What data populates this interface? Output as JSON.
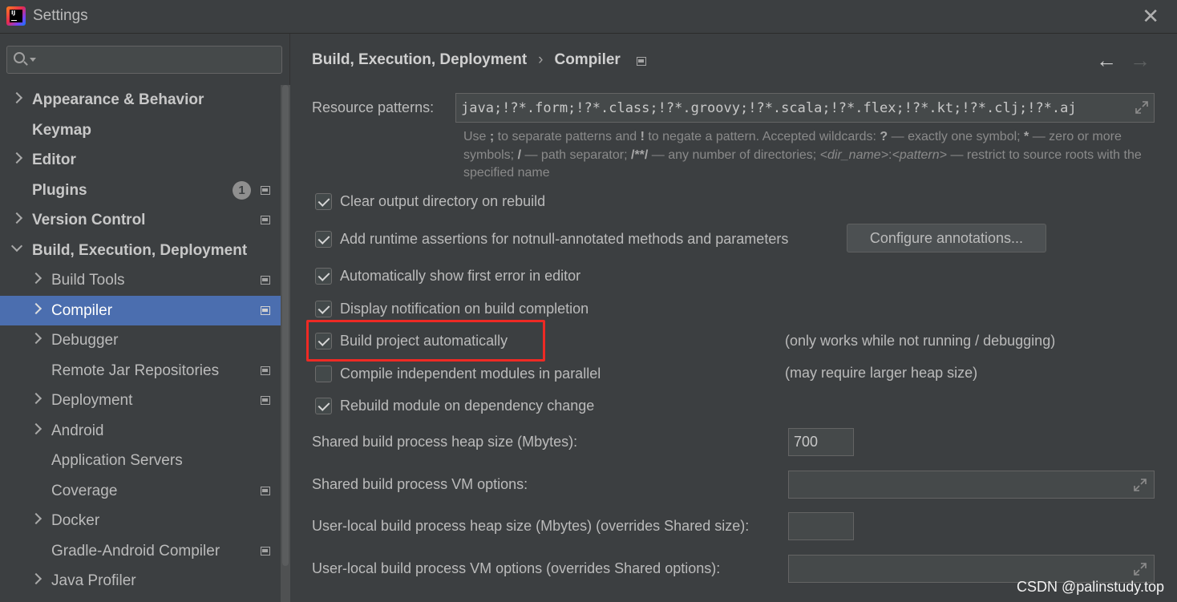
{
  "window": {
    "title": "Settings"
  },
  "search": {
    "value": "",
    "placeholder": ""
  },
  "sidebar": {
    "items": [
      {
        "label": "Appearance & Behavior"
      },
      {
        "label": "Keymap"
      },
      {
        "label": "Editor"
      },
      {
        "label": "Plugins",
        "badge": "1"
      },
      {
        "label": "Version Control"
      },
      {
        "label": "Build, Execution, Deployment"
      },
      {
        "label": "Build Tools"
      },
      {
        "label": "Compiler"
      },
      {
        "label": "Debugger"
      },
      {
        "label": "Remote Jar Repositories"
      },
      {
        "label": "Deployment"
      },
      {
        "label": "Android"
      },
      {
        "label": "Application Servers"
      },
      {
        "label": "Coverage"
      },
      {
        "label": "Docker"
      },
      {
        "label": "Gradle-Android Compiler"
      },
      {
        "label": "Java Profiler"
      }
    ],
    "selected": "Compiler"
  },
  "breadcrumb": {
    "parent": "Build, Execution, Deployment",
    "sep": "›",
    "current": "Compiler"
  },
  "nav": {
    "back": "←",
    "forward": "→"
  },
  "compiler": {
    "resource_patterns_label": "Resource patterns:",
    "resource_patterns_value": "java;!?*.form;!?*.class;!?*.groovy;!?*.scala;!?*.flex;!?*.kt;!?*.clj;!?*.aj",
    "hint": {
      "p1": "Use ",
      "b1": ";",
      "p2": " to separate patterns and ",
      "b2": "!",
      "p3": " to negate a pattern. Accepted wildcards: ",
      "b3": "?",
      "p4": " — exactly one symbol; ",
      "b4": "*",
      "p5": " — zero or more symbols; ",
      "b5": "/",
      "p6": " — path separator; ",
      "b6": "/**/",
      "p7": " — any number of directories; ",
      "i1": "<dir_name>",
      "p8": ":",
      "i2": "<pattern>",
      "p9": " — restrict to source roots with the specified name"
    },
    "checkboxes": [
      {
        "label": "Clear output directory on rebuild",
        "checked": true
      },
      {
        "label": "Add runtime assertions for notnull-annotated methods and parameters",
        "checked": true
      },
      {
        "label": "Automatically show first error in editor",
        "checked": true
      },
      {
        "label": "Display notification on build completion",
        "checked": true
      },
      {
        "label": "Build project automatically",
        "checked": true,
        "note": "(only works while not running / debugging)"
      },
      {
        "label": "Compile independent modules in parallel",
        "checked": false,
        "note": "(may require larger heap size)"
      },
      {
        "label": "Rebuild module on dependency change",
        "checked": true
      }
    ],
    "configure_button": "Configure annotations...",
    "shared_heap_label": "Shared build process heap size (Mbytes):",
    "shared_heap_value": "700",
    "shared_vm_label": "Shared build process VM options:",
    "shared_vm_value": "",
    "user_heap_label": "User-local build process heap size (Mbytes) (overrides Shared size):",
    "user_heap_value": "",
    "user_vm_label": "User-local build process VM options (overrides Shared options):",
    "user_vm_value": ""
  },
  "watermark": "CSDN @palinstudy.top",
  "colors": {
    "selection": "#4b6eaf",
    "highlight_border": "#ee2a24",
    "background": "#3c3f41"
  }
}
